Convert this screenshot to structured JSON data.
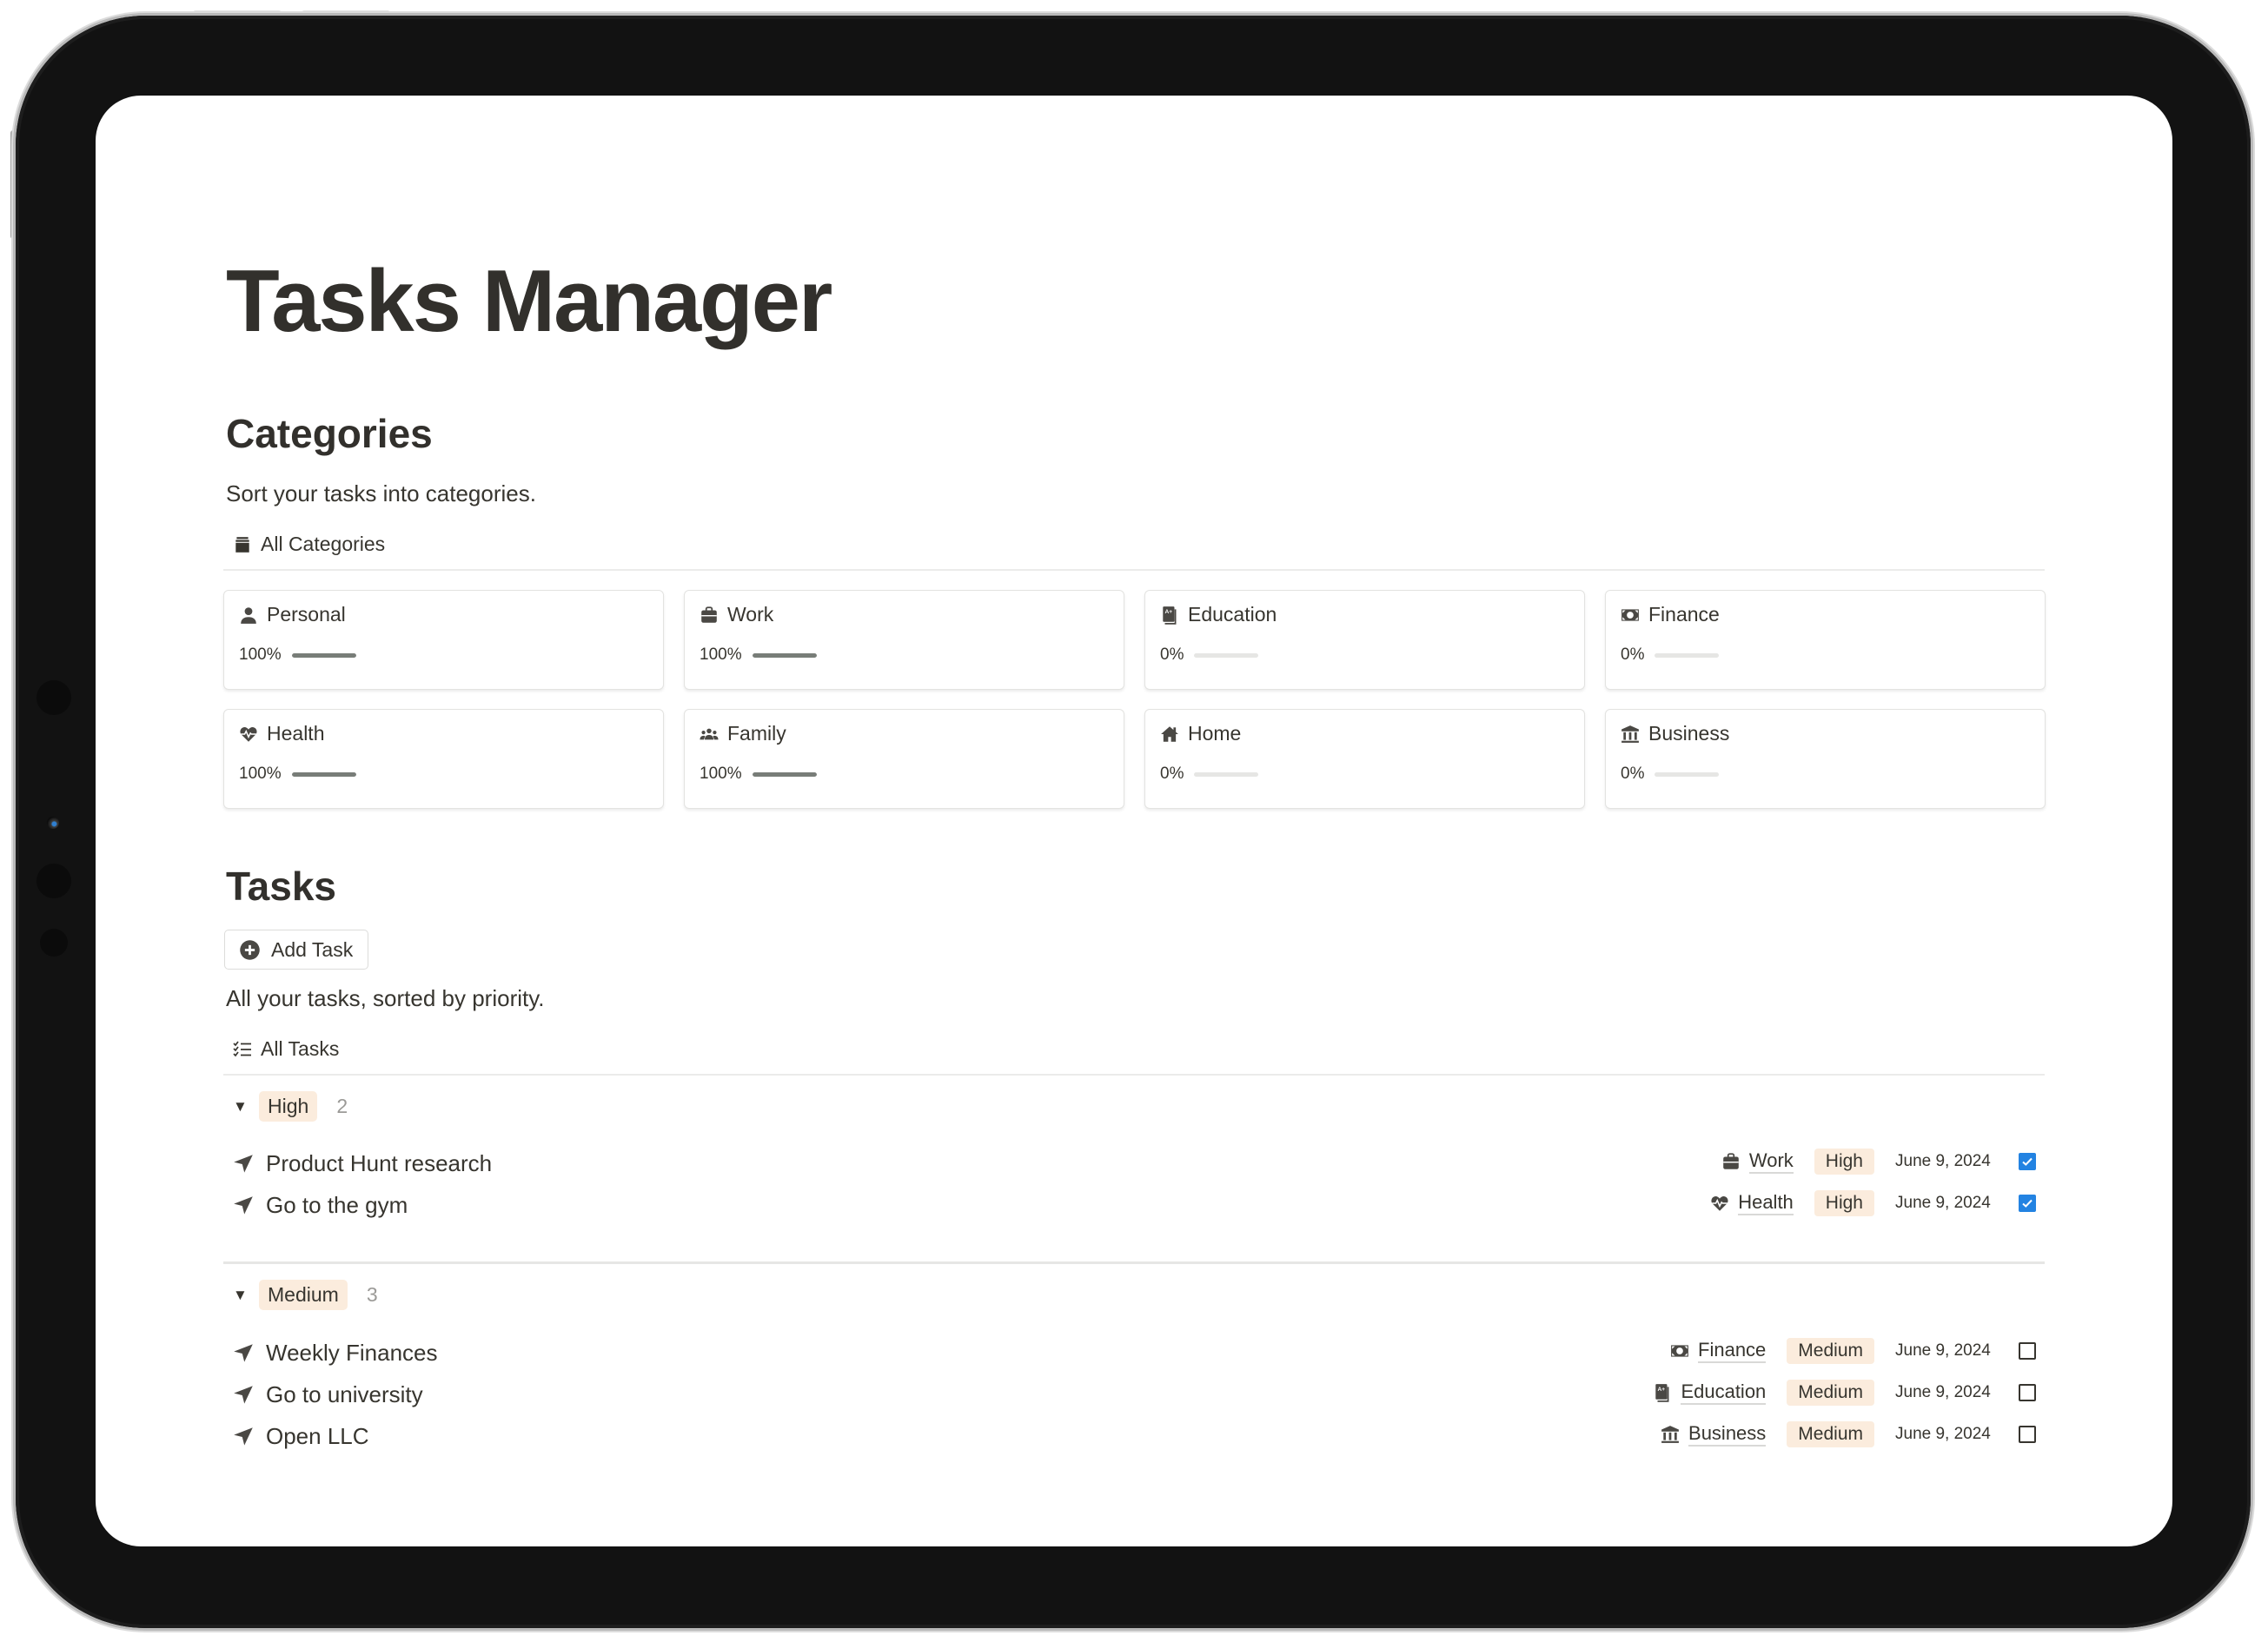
{
  "page": {
    "title": "Tasks Manager"
  },
  "categories_section": {
    "heading": "Categories",
    "description": "Sort your tasks into categories.",
    "view_label": "All Categories",
    "view_icon": "archive-icon",
    "cards": [
      {
        "name": "Personal",
        "icon": "person-icon",
        "progress_label": "100%",
        "progress": 1.0
      },
      {
        "name": "Work",
        "icon": "briefcase-icon",
        "progress_label": "100%",
        "progress": 1.0
      },
      {
        "name": "Education",
        "icon": "grade-book-icon",
        "progress_label": "0%",
        "progress": 0.0
      },
      {
        "name": "Finance",
        "icon": "banknote-icon",
        "progress_label": "0%",
        "progress": 0.0
      },
      {
        "name": "Health",
        "icon": "heart-pulse-icon",
        "progress_label": "100%",
        "progress": 1.0
      },
      {
        "name": "Family",
        "icon": "people-group-icon",
        "progress_label": "100%",
        "progress": 1.0
      },
      {
        "name": "Home",
        "icon": "house-icon",
        "progress_label": "0%",
        "progress": 0.0
      },
      {
        "name": "Business",
        "icon": "bank-building-icon",
        "progress_label": "0%",
        "progress": 0.0
      }
    ]
  },
  "tasks_section": {
    "heading": "Tasks",
    "add_button_label": "Add Task",
    "description": "All your tasks, sorted by priority.",
    "view_label": "All Tasks",
    "view_icon": "checklist-icon",
    "groups": [
      {
        "label": "High",
        "count": "2",
        "tasks": [
          {
            "title": "Product Hunt research",
            "category": "Work",
            "category_icon": "briefcase-icon",
            "priority": "High",
            "date": "June 9, 2024",
            "done": true
          },
          {
            "title": "Go to the gym",
            "category": "Health",
            "category_icon": "heart-pulse-icon",
            "priority": "High",
            "date": "June 9, 2024",
            "done": true
          }
        ]
      },
      {
        "label": "Medium",
        "count": "3",
        "tasks": [
          {
            "title": "Weekly Finances",
            "category": "Finance",
            "category_icon": "banknote-icon",
            "priority": "Medium",
            "date": "June 9, 2024",
            "done": false
          },
          {
            "title": "Go to university",
            "category": "Education",
            "category_icon": "grade-book-icon",
            "priority": "Medium",
            "date": "June 9, 2024",
            "done": false
          },
          {
            "title": "Open LLC",
            "category": "Business",
            "category_icon": "bank-building-icon",
            "priority": "Medium",
            "date": "June 9, 2024",
            "done": false
          }
        ]
      }
    ]
  },
  "colors": {
    "text": "#37352f",
    "priority_tag_bg": "#fbecdd",
    "checkbox_checked": "#2383e2",
    "progress_fill": "#787d78",
    "progress_track": "#e6e6e4"
  }
}
